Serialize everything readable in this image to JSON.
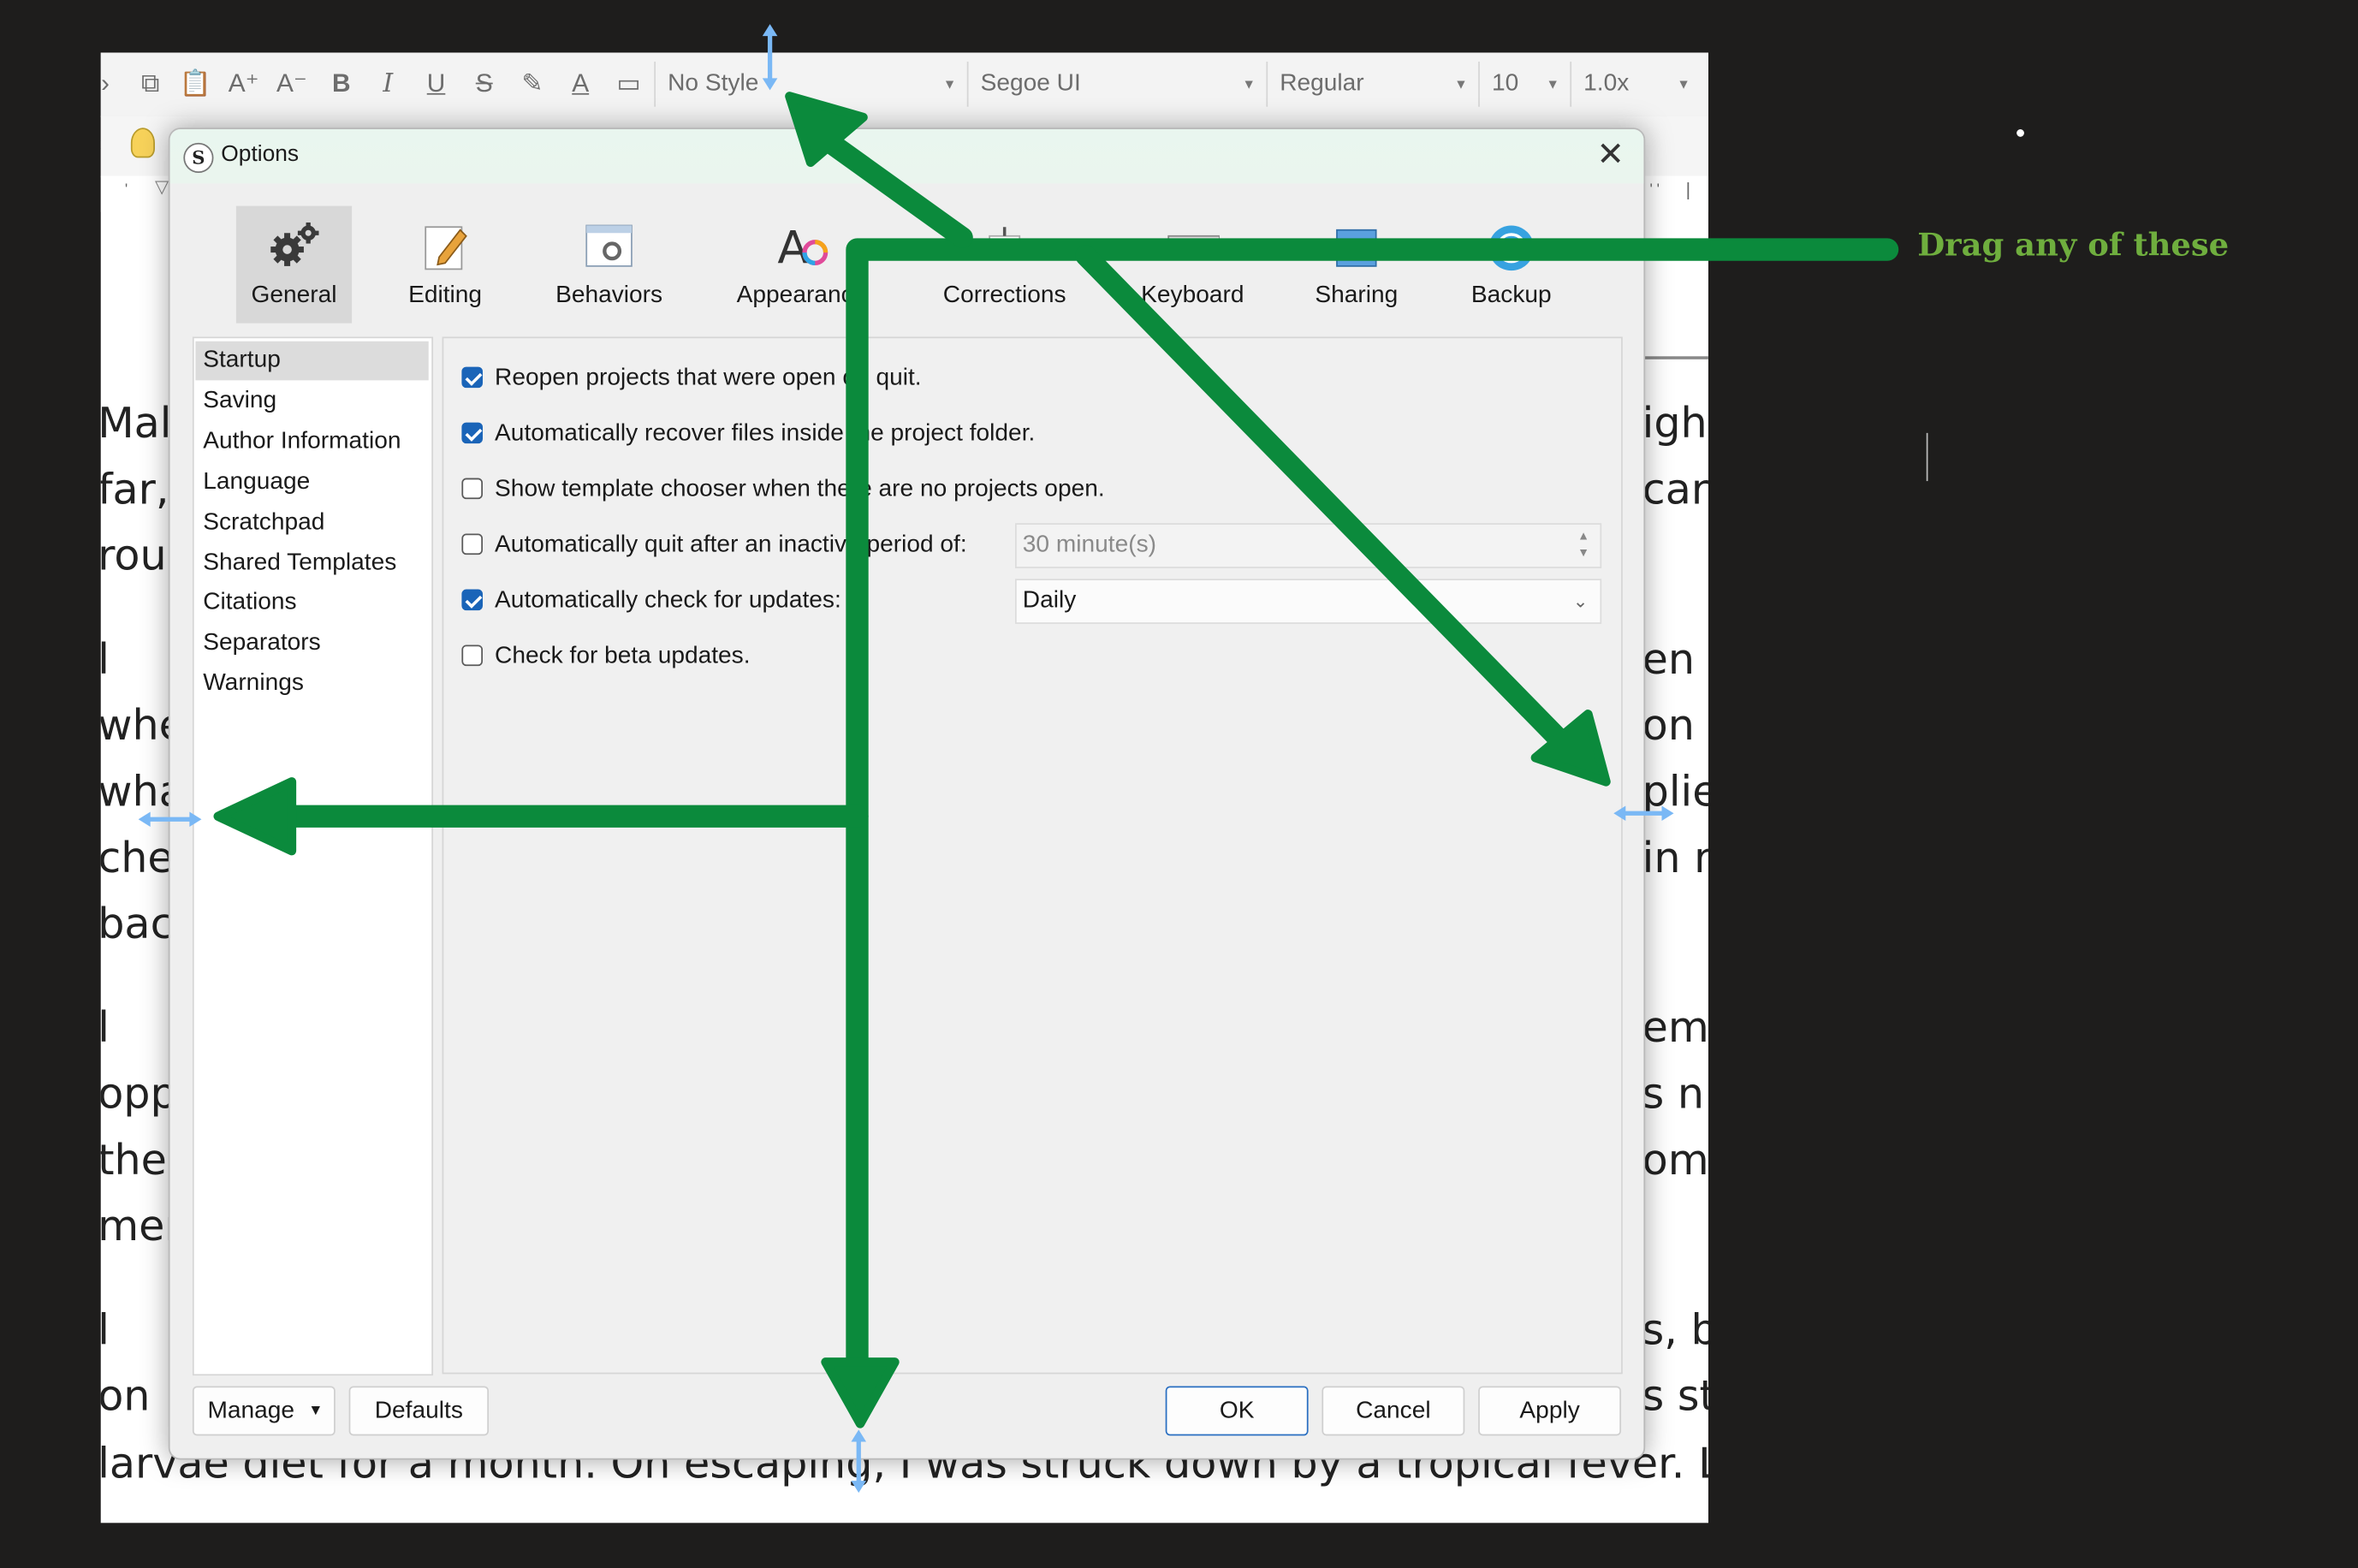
{
  "toolbar": {
    "style_select": "No Style",
    "font_select": "Segoe UI",
    "weight_select": "Regular",
    "size_select": "10",
    "spacing_select": "1.0x"
  },
  "document": {
    "lines": [
      {
        "left": "Mal",
        "right": "ight"
      },
      {
        "left": "far,",
        "right": "carr"
      },
      {
        "left": "rous",
        "right": ""
      },
      {
        "left": "l",
        "right": "en c"
      },
      {
        "left": "whe",
        "right": "on"
      },
      {
        "left": "wha",
        "right": "plie"
      },
      {
        "left": "che",
        "right": "in r"
      },
      {
        "left": "bac",
        "right": ""
      },
      {
        "left": "l",
        "right": "em."
      },
      {
        "left": "opp",
        "right": "s n"
      },
      {
        "left": "the",
        "right": "om"
      },
      {
        "left": "mer",
        "right": ""
      },
      {
        "left": "l",
        "right": "s, b"
      },
      {
        "left": "on",
        "right": "s st"
      }
    ],
    "bottom_line": "larvae diet for a month. On escaping, I was struck down by a tropical fever. Later"
  },
  "dialog": {
    "title": "Options",
    "tabs": [
      {
        "label": "General",
        "icon": "gears-icon"
      },
      {
        "label": "Editing",
        "icon": "pencil-icon"
      },
      {
        "label": "Behaviors",
        "icon": "window-gear-icon"
      },
      {
        "label": "Appearance",
        "icon": "font-color-icon"
      },
      {
        "label": "Corrections",
        "icon": "corrections-icon"
      },
      {
        "label": "Keyboard",
        "icon": "keyboard-icon"
      },
      {
        "label": "Sharing",
        "icon": "sharing-icon"
      },
      {
        "label": "Backup",
        "icon": "backup-icon"
      }
    ],
    "categories": [
      "Startup",
      "Saving",
      "Author Information",
      "Language",
      "Scratchpad",
      "Shared Templates",
      "Citations",
      "Separators",
      "Warnings"
    ],
    "selected_category": "Startup",
    "options": [
      {
        "label": "Reopen projects that were open on quit.",
        "checked": true
      },
      {
        "label": "Automatically recover files inside the project folder.",
        "checked": true
      },
      {
        "label": "Show template chooser when there are no projects open.",
        "checked": false
      },
      {
        "label": "Automatically quit after an inactive period of:",
        "checked": false
      },
      {
        "label": "Automatically check for updates:",
        "checked": true
      },
      {
        "label": "Check for beta updates.",
        "checked": false
      }
    ],
    "quit_period": "30 minute(s)",
    "update_frequency": "Daily",
    "buttons": {
      "manage": "Manage",
      "defaults": "Defaults",
      "ok": "OK",
      "cancel": "Cancel",
      "apply": "Apply"
    }
  },
  "annotation": {
    "text": "Drag any of these",
    "arrow_color": "#0b8a3c",
    "handle_color": "#7ab8f5",
    "text_color": "#6fae3e"
  }
}
